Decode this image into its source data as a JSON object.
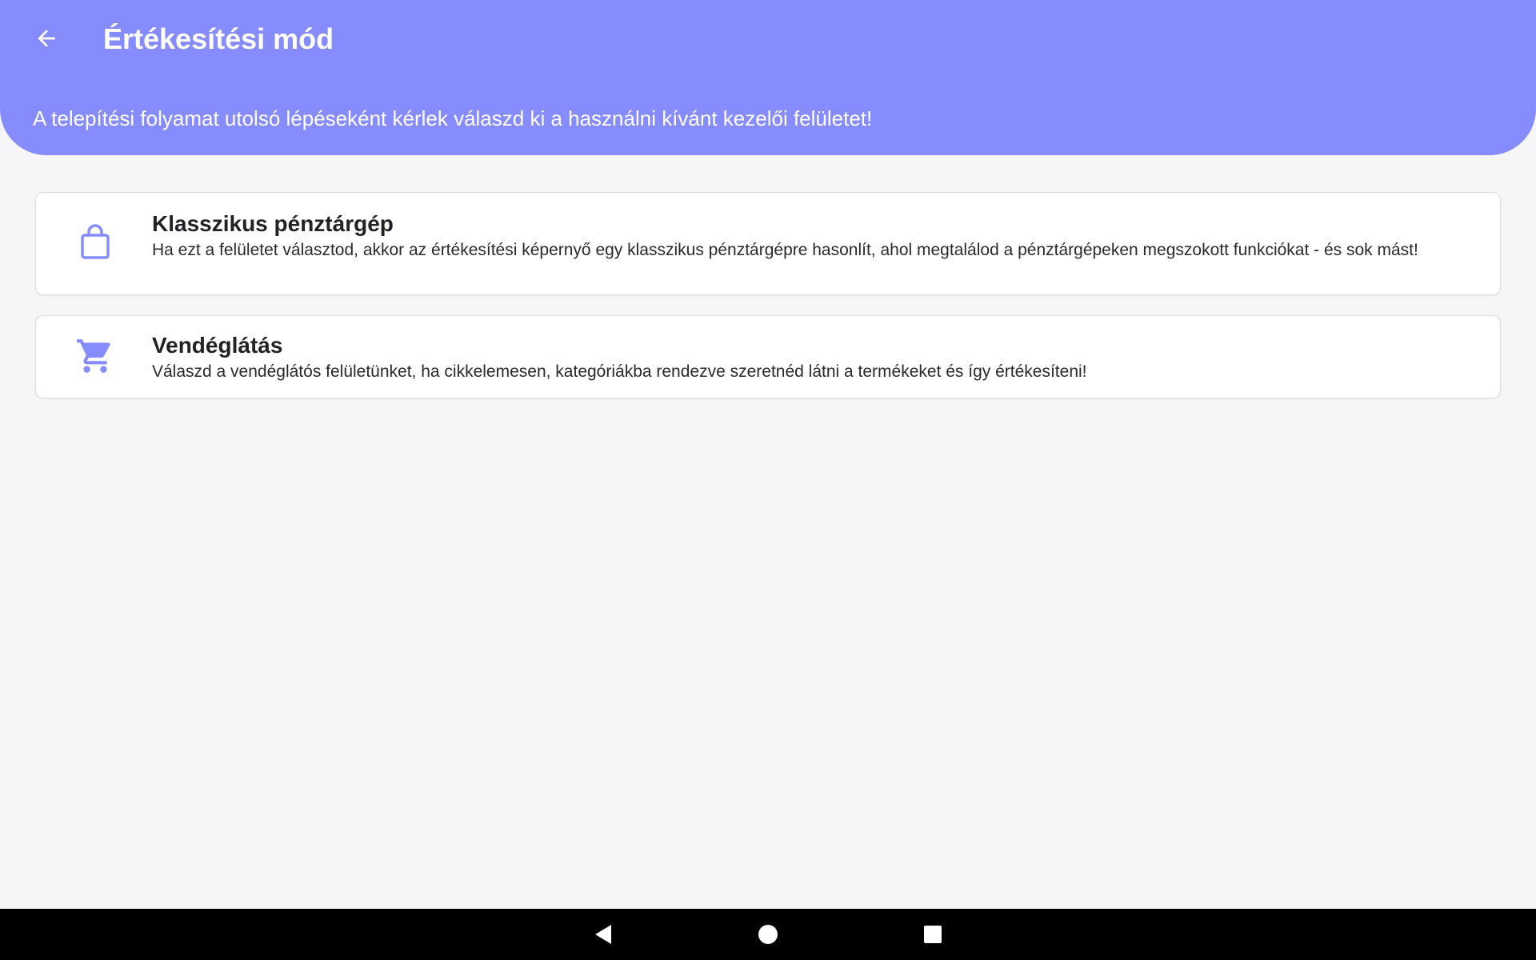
{
  "header": {
    "title": "Értékesítési mód",
    "subtitle": "A telepítési folyamat utolsó lépéseként kérlek válaszd ki a használni kívánt kezelői felületet!",
    "back_icon": "arrow-left-icon"
  },
  "options": [
    {
      "icon": "shopping-bag-icon",
      "title": "Klasszikus pénztárgép",
      "description": "Ha ezt a felületet választod, akkor az értékesítési képernyő egy klasszikus pénztárgépre hasonlít, ahol megtalálod a pénztárgépeken megszokott funkciókat - és sok mást!"
    },
    {
      "icon": "shopping-cart-icon",
      "title": "Vendéglátás",
      "description": "Válaszd a vendéglátós felületünket, ha cikkelemesen, kategóriákba rendezve szeretnéd látni a termékeket és így értékesíteni!"
    }
  ],
  "navigation_bar": {
    "back_icon": "nav-back-triangle-icon",
    "home_icon": "nav-home-circle-icon",
    "recents_icon": "nav-recents-square-icon"
  },
  "colors": {
    "header_background": "#868cfd",
    "accent_icon": "#868cfd",
    "page_background": "#f6f6f8",
    "card_background": "#ffffff",
    "navbar_background": "#000000"
  }
}
